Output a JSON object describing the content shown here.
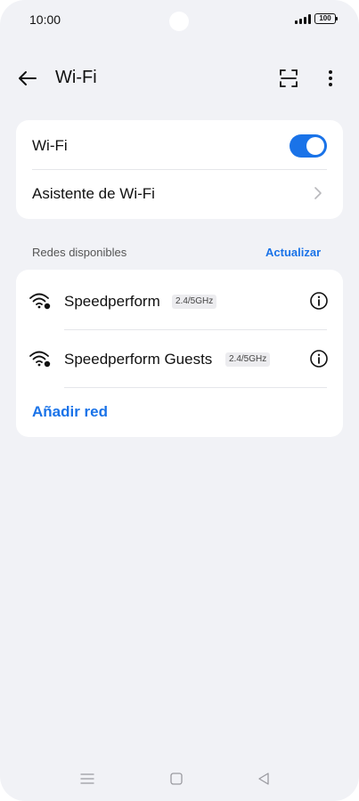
{
  "status_bar": {
    "time": "10:00",
    "battery": "100"
  },
  "header": {
    "title": "Wi-Fi",
    "back_icon": "arrow-left-icon",
    "scan_icon": "qr-scan-icon",
    "more_icon": "more-vertical-icon"
  },
  "wifi_card": {
    "wifi_label": "Wi-Fi",
    "wifi_enabled": true,
    "assistant_label": "Asistente de Wi-Fi"
  },
  "networks_section": {
    "label": "Redes disponibles",
    "refresh_label": "Actualizar",
    "networks": [
      {
        "name": "Speedperform",
        "band": "2.4/5GHz"
      },
      {
        "name": "Speedperform Guests",
        "band": "2.4/5GHz"
      }
    ],
    "add_network_label": "Añadir red"
  },
  "colors": {
    "accent": "#1a73e8",
    "background": "#f1f2f6",
    "card": "#ffffff"
  }
}
